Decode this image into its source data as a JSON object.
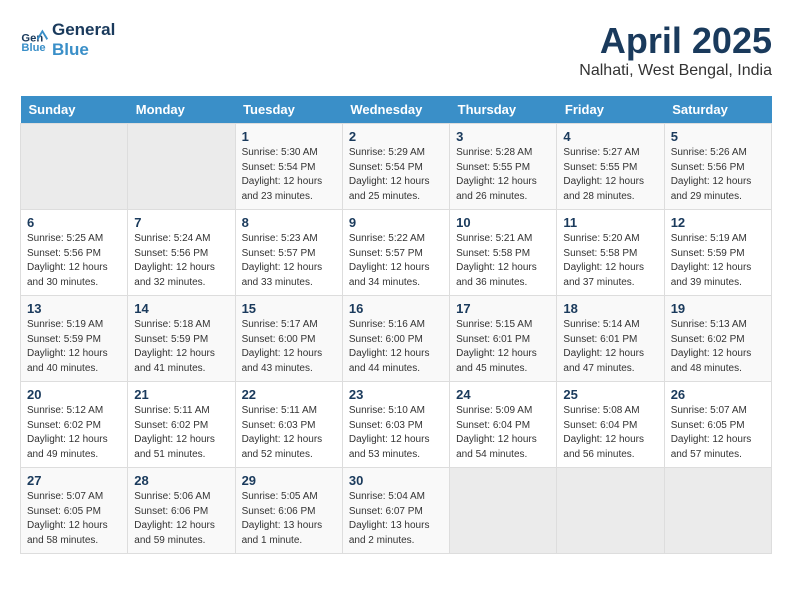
{
  "header": {
    "logo_line1": "General",
    "logo_line2": "Blue",
    "main_title": "April 2025",
    "sub_title": "Nalhati, West Bengal, India"
  },
  "weekdays": [
    "Sunday",
    "Monday",
    "Tuesday",
    "Wednesday",
    "Thursday",
    "Friday",
    "Saturday"
  ],
  "weeks": [
    [
      {
        "day": "",
        "empty": true
      },
      {
        "day": "",
        "empty": true
      },
      {
        "day": "1",
        "sunrise": "Sunrise: 5:30 AM",
        "sunset": "Sunset: 5:54 PM",
        "daylight": "Daylight: 12 hours and 23 minutes."
      },
      {
        "day": "2",
        "sunrise": "Sunrise: 5:29 AM",
        "sunset": "Sunset: 5:54 PM",
        "daylight": "Daylight: 12 hours and 25 minutes."
      },
      {
        "day": "3",
        "sunrise": "Sunrise: 5:28 AM",
        "sunset": "Sunset: 5:55 PM",
        "daylight": "Daylight: 12 hours and 26 minutes."
      },
      {
        "day": "4",
        "sunrise": "Sunrise: 5:27 AM",
        "sunset": "Sunset: 5:55 PM",
        "daylight": "Daylight: 12 hours and 28 minutes."
      },
      {
        "day": "5",
        "sunrise": "Sunrise: 5:26 AM",
        "sunset": "Sunset: 5:56 PM",
        "daylight": "Daylight: 12 hours and 29 minutes."
      }
    ],
    [
      {
        "day": "6",
        "sunrise": "Sunrise: 5:25 AM",
        "sunset": "Sunset: 5:56 PM",
        "daylight": "Daylight: 12 hours and 30 minutes."
      },
      {
        "day": "7",
        "sunrise": "Sunrise: 5:24 AM",
        "sunset": "Sunset: 5:56 PM",
        "daylight": "Daylight: 12 hours and 32 minutes."
      },
      {
        "day": "8",
        "sunrise": "Sunrise: 5:23 AM",
        "sunset": "Sunset: 5:57 PM",
        "daylight": "Daylight: 12 hours and 33 minutes."
      },
      {
        "day": "9",
        "sunrise": "Sunrise: 5:22 AM",
        "sunset": "Sunset: 5:57 PM",
        "daylight": "Daylight: 12 hours and 34 minutes."
      },
      {
        "day": "10",
        "sunrise": "Sunrise: 5:21 AM",
        "sunset": "Sunset: 5:58 PM",
        "daylight": "Daylight: 12 hours and 36 minutes."
      },
      {
        "day": "11",
        "sunrise": "Sunrise: 5:20 AM",
        "sunset": "Sunset: 5:58 PM",
        "daylight": "Daylight: 12 hours and 37 minutes."
      },
      {
        "day": "12",
        "sunrise": "Sunrise: 5:19 AM",
        "sunset": "Sunset: 5:59 PM",
        "daylight": "Daylight: 12 hours and 39 minutes."
      }
    ],
    [
      {
        "day": "13",
        "sunrise": "Sunrise: 5:19 AM",
        "sunset": "Sunset: 5:59 PM",
        "daylight": "Daylight: 12 hours and 40 minutes."
      },
      {
        "day": "14",
        "sunrise": "Sunrise: 5:18 AM",
        "sunset": "Sunset: 5:59 PM",
        "daylight": "Daylight: 12 hours and 41 minutes."
      },
      {
        "day": "15",
        "sunrise": "Sunrise: 5:17 AM",
        "sunset": "Sunset: 6:00 PM",
        "daylight": "Daylight: 12 hours and 43 minutes."
      },
      {
        "day": "16",
        "sunrise": "Sunrise: 5:16 AM",
        "sunset": "Sunset: 6:00 PM",
        "daylight": "Daylight: 12 hours and 44 minutes."
      },
      {
        "day": "17",
        "sunrise": "Sunrise: 5:15 AM",
        "sunset": "Sunset: 6:01 PM",
        "daylight": "Daylight: 12 hours and 45 minutes."
      },
      {
        "day": "18",
        "sunrise": "Sunrise: 5:14 AM",
        "sunset": "Sunset: 6:01 PM",
        "daylight": "Daylight: 12 hours and 47 minutes."
      },
      {
        "day": "19",
        "sunrise": "Sunrise: 5:13 AM",
        "sunset": "Sunset: 6:02 PM",
        "daylight": "Daylight: 12 hours and 48 minutes."
      }
    ],
    [
      {
        "day": "20",
        "sunrise": "Sunrise: 5:12 AM",
        "sunset": "Sunset: 6:02 PM",
        "daylight": "Daylight: 12 hours and 49 minutes."
      },
      {
        "day": "21",
        "sunrise": "Sunrise: 5:11 AM",
        "sunset": "Sunset: 6:02 PM",
        "daylight": "Daylight: 12 hours and 51 minutes."
      },
      {
        "day": "22",
        "sunrise": "Sunrise: 5:11 AM",
        "sunset": "Sunset: 6:03 PM",
        "daylight": "Daylight: 12 hours and 52 minutes."
      },
      {
        "day": "23",
        "sunrise": "Sunrise: 5:10 AM",
        "sunset": "Sunset: 6:03 PM",
        "daylight": "Daylight: 12 hours and 53 minutes."
      },
      {
        "day": "24",
        "sunrise": "Sunrise: 5:09 AM",
        "sunset": "Sunset: 6:04 PM",
        "daylight": "Daylight: 12 hours and 54 minutes."
      },
      {
        "day": "25",
        "sunrise": "Sunrise: 5:08 AM",
        "sunset": "Sunset: 6:04 PM",
        "daylight": "Daylight: 12 hours and 56 minutes."
      },
      {
        "day": "26",
        "sunrise": "Sunrise: 5:07 AM",
        "sunset": "Sunset: 6:05 PM",
        "daylight": "Daylight: 12 hours and 57 minutes."
      }
    ],
    [
      {
        "day": "27",
        "sunrise": "Sunrise: 5:07 AM",
        "sunset": "Sunset: 6:05 PM",
        "daylight": "Daylight: 12 hours and 58 minutes."
      },
      {
        "day": "28",
        "sunrise": "Sunrise: 5:06 AM",
        "sunset": "Sunset: 6:06 PM",
        "daylight": "Daylight: 12 hours and 59 minutes."
      },
      {
        "day": "29",
        "sunrise": "Sunrise: 5:05 AM",
        "sunset": "Sunset: 6:06 PM",
        "daylight": "Daylight: 13 hours and 1 minute."
      },
      {
        "day": "30",
        "sunrise": "Sunrise: 5:04 AM",
        "sunset": "Sunset: 6:07 PM",
        "daylight": "Daylight: 13 hours and 2 minutes."
      },
      {
        "day": "",
        "empty": true
      },
      {
        "day": "",
        "empty": true
      },
      {
        "day": "",
        "empty": true
      }
    ]
  ]
}
